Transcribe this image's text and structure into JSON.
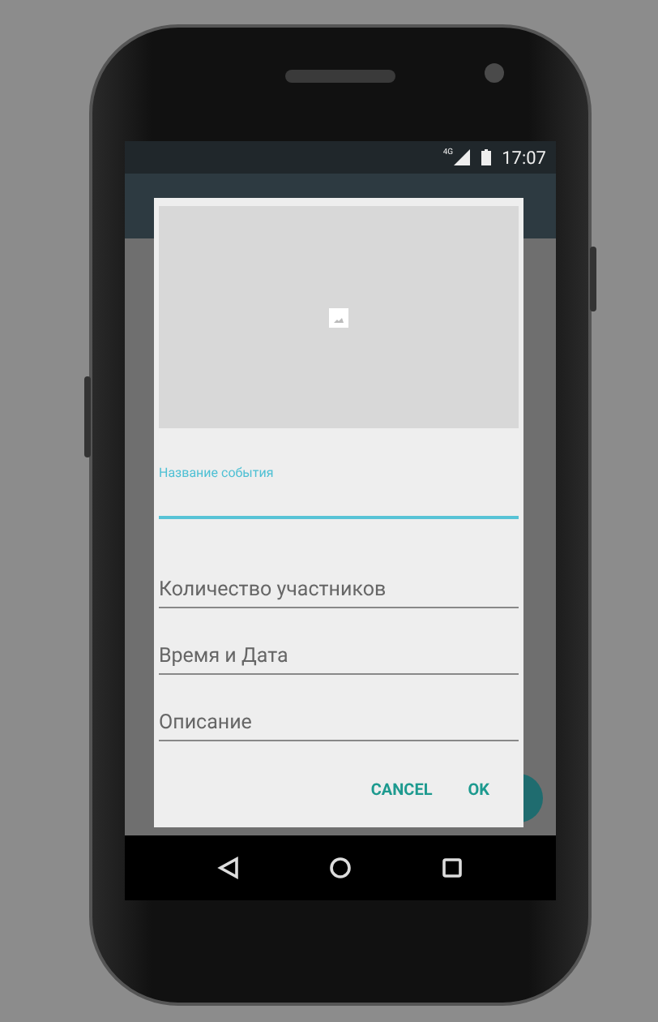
{
  "status_bar": {
    "network": "4G",
    "time": "17:07"
  },
  "dialog": {
    "fields": [
      {
        "placeholder": "Название события",
        "focused": true
      },
      {
        "placeholder": "Количество участников",
        "focused": false
      },
      {
        "placeholder": "Время и Дата",
        "focused": false
      },
      {
        "placeholder": "Описание",
        "focused": false
      }
    ],
    "buttons": [
      "CANCEL",
      "OK"
    ]
  }
}
